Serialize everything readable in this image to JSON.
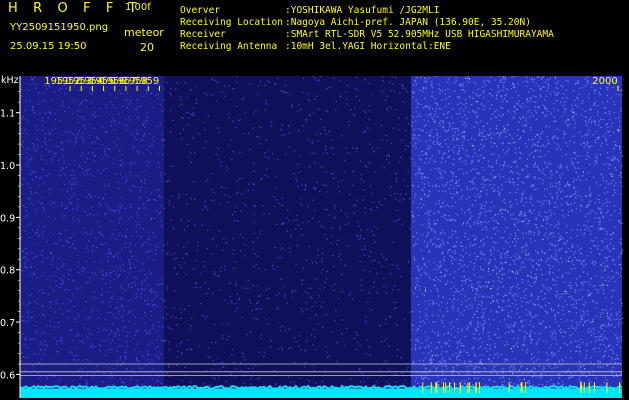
{
  "header": {
    "app_name": "H R O F F T",
    "version": "1.00f",
    "filename": "YY2509151950.png",
    "datetime": "25.09.15 19:50",
    "meteor_label": "meteor",
    "meteor_count": "20",
    "meta": [
      {
        "key": "Overver",
        "value": ":YOSHIKAWA Yasufumi /JG2MLI"
      },
      {
        "key": "Receiving Location",
        "value": ":Nagoya Aichi-pref. JAPAN (136.90E, 35.20N)"
      },
      {
        "key": "Receiver",
        "value": ":SMArt RTL-SDR V5 52.905MHz USB HIGASHIMURAYAMA"
      },
      {
        "key": "Receiving Antenna",
        "value": ":10mH 3el.YAGI Horizontal:ENE"
      }
    ]
  },
  "chart_data": {
    "type": "heatmap",
    "title": "",
    "y_unit": "kHz",
    "y_ticks": [
      "1.1",
      "1.0",
      "0.9",
      "0.8",
      "0.7",
      "0.6"
    ],
    "ylim": [
      0.6,
      1.1
    ],
    "x_ticks": [
      "1951",
      "1952",
      "1953",
      "1954",
      "1955",
      "1956",
      "1957",
      "1958",
      "1959",
      "2000"
    ],
    "segments": [
      {
        "from": "1950",
        "to": "1952.5",
        "intensity": 0.45
      },
      {
        "from": "1952.5",
        "to": "1956.5",
        "intensity": 0.25
      },
      {
        "from": "1956.5",
        "to": "2000",
        "intensity": 0.75
      }
    ],
    "colors": {
      "background": "#000000",
      "low": "#1a1a80",
      "high": "#6080ff",
      "peak": "#ffffff",
      "baseline": "#00e5ff",
      "meteor_tick": "#ffff00",
      "reference_lines": "#c8c8c8"
    }
  }
}
